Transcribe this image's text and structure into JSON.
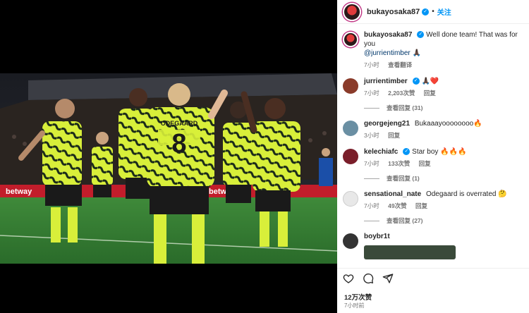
{
  "post_header": {
    "username": "bukayosaka87",
    "follow_label": "关注",
    "separator": "•"
  },
  "caption": {
    "username": "bukayosaka87",
    "text": "Well done team! That was for you",
    "mention": "@jurrientimber",
    "emoji": "🙏🏿",
    "time": "7小时",
    "translate_label": "查看翻译"
  },
  "comments": [
    {
      "username": "jurrientimber",
      "text": "🙏🏿❤️",
      "time": "7小时",
      "likes": "2,203次赞",
      "reply_label": "回复",
      "view_replies": "查看回复 (31)",
      "avatar_color": "#8a3b2a"
    },
    {
      "username": "georgejeng21",
      "text": "Bukaaayoooooooo🔥",
      "time": "3小时",
      "likes": "",
      "reply_label": "回复",
      "view_replies": "",
      "avatar_color": "#6a8fa3"
    },
    {
      "username": "kelechiafc",
      "text": "Star boy 🔥🔥🔥",
      "time": "7小时",
      "likes": "133次赞",
      "reply_label": "回复",
      "view_replies": "查看回复 (1)",
      "avatar_color": "#7a1e2a"
    },
    {
      "username": "sensational_nate",
      "text": "Odegaard is overrated 🤔",
      "time": "7小时",
      "likes": "49次赞",
      "reply_label": "回复",
      "view_replies": "查看回复 (27)",
      "avatar_color": "#e8e8e8"
    },
    {
      "username": "boybr1t",
      "text": "",
      "time": "",
      "likes": "",
      "reply_label": "",
      "view_replies": "",
      "avatar_color": "#333333"
    }
  ],
  "footer": {
    "likes": "12万次赞",
    "time_ago": "7小时前"
  },
  "photo": {
    "jersey_name": "ODEGAARD",
    "jersey_number": "8",
    "board_text": "betway"
  },
  "icons": [
    "heart-icon",
    "comment-icon",
    "share-icon",
    "verified-icon",
    "like-heart-icon"
  ],
  "colors": {
    "verified": "#0095f6",
    "link": "#00376b",
    "kit_yellow": "#d8ef3a",
    "kit_dark": "#1a2a1a",
    "pitch": "#2e7d2e"
  }
}
